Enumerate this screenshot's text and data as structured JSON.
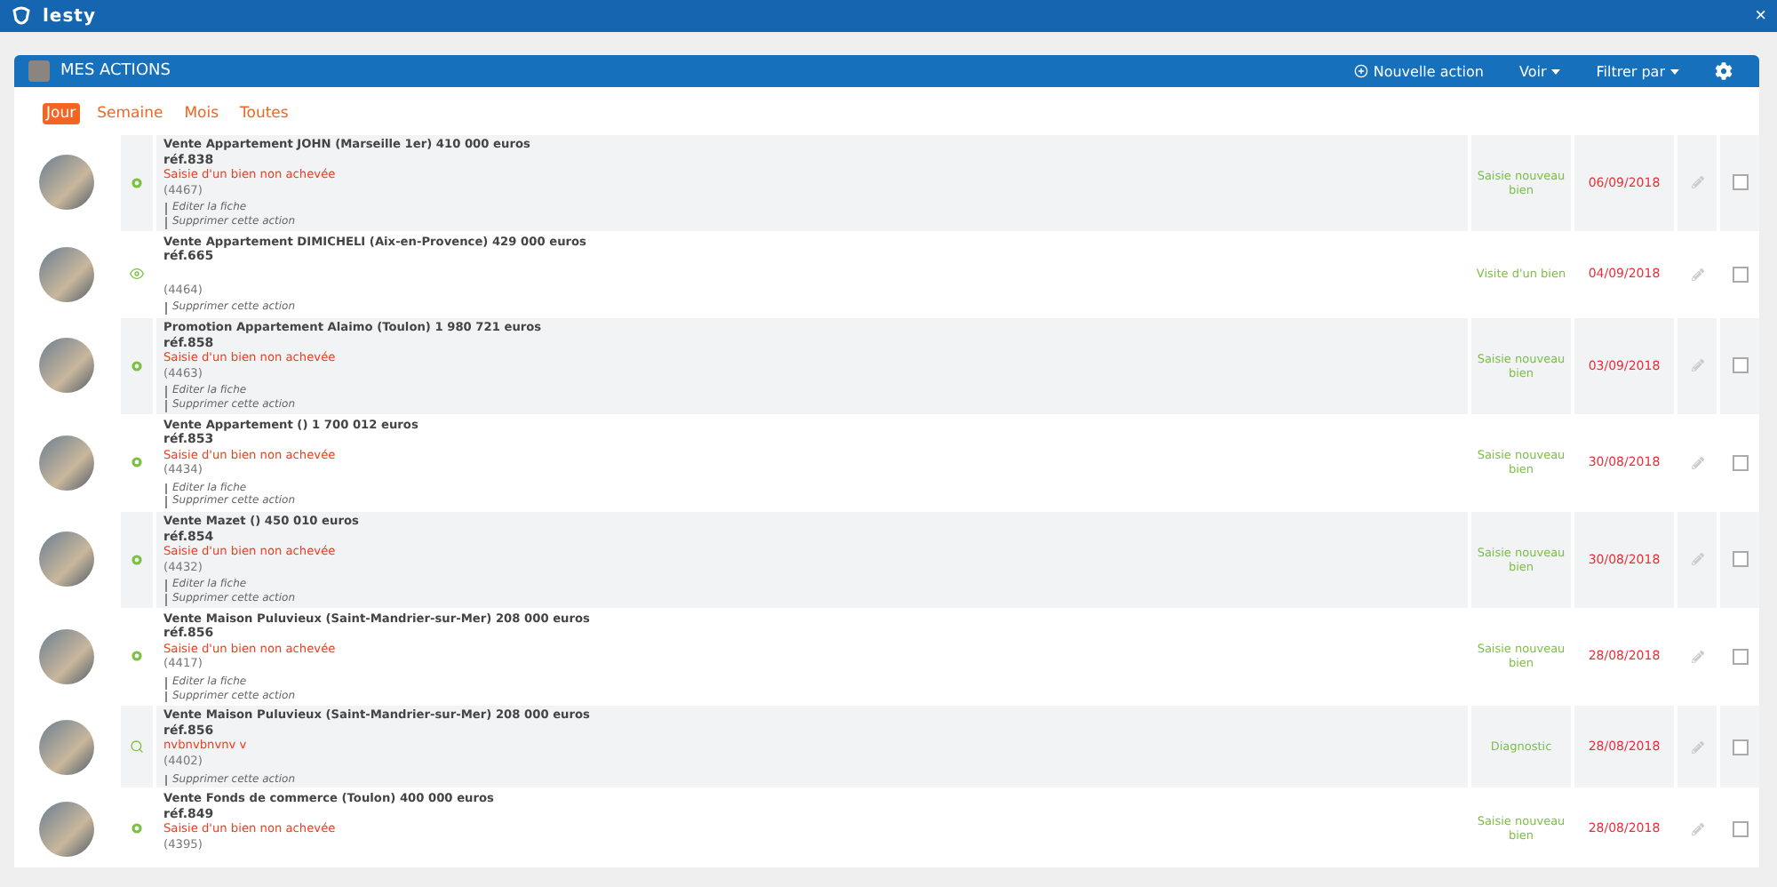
{
  "app": {
    "title": "lesty",
    "close": "×"
  },
  "panel": {
    "title": "MES ACTIONS",
    "toolbar": [
      {
        "kind": "new",
        "label": "Nouvelle action"
      },
      {
        "kind": "menu",
        "label": "Voir"
      },
      {
        "kind": "menu",
        "label": "Filtrer par"
      },
      {
        "kind": "settings"
      }
    ]
  },
  "tabs": [
    {
      "label": "Jour",
      "selected": true
    },
    {
      "label": "Semaine",
      "selected": false
    },
    {
      "label": "Mois",
      "selected": false
    },
    {
      "label": "Toutes",
      "selected": false
    }
  ],
  "rows": [
    {
      "kind": "circle",
      "title": "Vente Appartement JOHN (Marseille 1er) 410 000 euros",
      "ref": "réf.838",
      "status": "Saisie d'un bien non achevée",
      "id": "(4467)",
      "links": [
        "Editer la fiche",
        "Supprimer cette action"
      ],
      "type": "Saisie nouveau bien",
      "date": "06/09/2018",
      "checked": false
    },
    {
      "kind": "eye",
      "title": "Vente Appartement DIMICHELI (Aix-en-Provence) 429 000 euros",
      "ref": "réf.665",
      "id": "(4464)",
      "links": [
        "Supprimer cette action"
      ],
      "type": "Visite d'un bien",
      "date": "04/09/2018",
      "checked": false
    },
    {
      "kind": "circle",
      "title": "Promotion Appartement Alaimo (Toulon) 1 980 721 euros",
      "ref": "réf.858",
      "status": "Saisie d'un bien non achevée",
      "id": "(4463)",
      "links": [
        "Editer la fiche",
        "Supprimer cette action"
      ],
      "type": "Saisie nouveau bien",
      "date": "03/09/2018",
      "checked": false
    },
    {
      "kind": "circle",
      "title": "Vente Appartement () 1 700 012 euros",
      "ref": "réf.853",
      "status": "Saisie d'un bien non achevée",
      "id": "(4434)",
      "links": [
        "Editer la fiche",
        "Supprimer cette action"
      ],
      "type": "Saisie nouveau bien",
      "date": "30/08/2018",
      "checked": false
    },
    {
      "kind": "circle",
      "title": "Vente Mazet () 450 010 euros",
      "ref": "réf.854",
      "status": "Saisie d'un bien non achevée",
      "id": "(4432)",
      "links": [
        "Editer la fiche",
        "Supprimer cette action"
      ],
      "type": "Saisie nouveau bien",
      "date": "30/08/2018",
      "checked": false
    },
    {
      "kind": "circle",
      "title": "Vente Maison Puluvieux (Saint-Mandrier-sur-Mer) 208 000 euros",
      "ref": "réf.856",
      "status": "Saisie d'un bien non achevée",
      "id": "(4417)",
      "links": [
        "Editer la fiche",
        "Supprimer cette action"
      ],
      "type": "Saisie nouveau bien",
      "date": "28/08/2018",
      "checked": false
    },
    {
      "kind": "search",
      "title": "Vente Maison Puluvieux (Saint-Mandrier-sur-Mer) 208 000 euros",
      "ref": "réf.856",
      "status": "nvbnvbnvnv v",
      "id": "(4402)",
      "links": [
        "Supprimer cette action"
      ],
      "type": "Diagnostic",
      "date": "28/08/2018",
      "checked": false
    },
    {
      "kind": "circle",
      "title": "Vente Fonds de commerce (Toulon) 400 000 euros",
      "ref": "réf.849",
      "status": "Saisie d'un bien non achevée",
      "id": "(4395)",
      "type": "Saisie nouveau bien",
      "date": "28/08/2018",
      "checked": false
    }
  ]
}
